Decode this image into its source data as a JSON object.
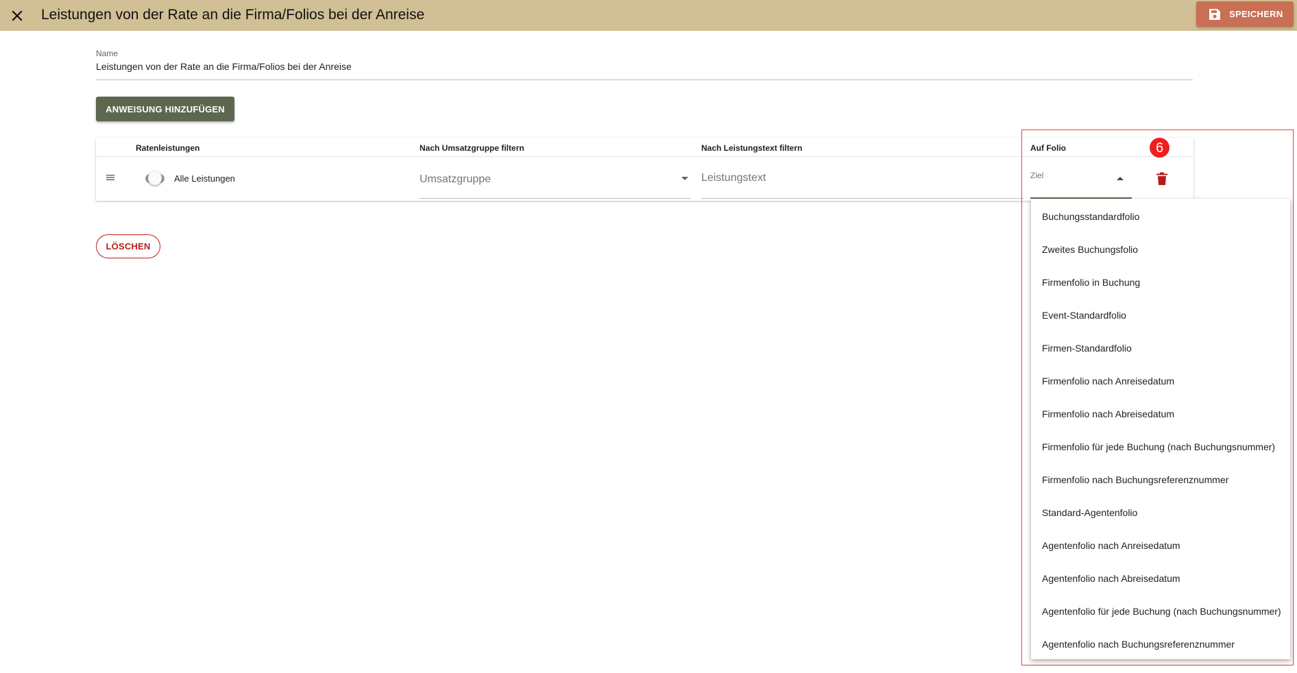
{
  "header": {
    "title": "Leistungen von der Rate an die Firma/Folios bei der Anreise",
    "close_icon": "close-icon",
    "save_label": "SPEICHERN",
    "save_icon": "floppy-disk-icon",
    "background_color": "#d1bf95",
    "save_color": "#c86f54"
  },
  "name_field": {
    "label": "Name",
    "value": "Leistungen von der Rate an die Firma/Folios bei der Anreise"
  },
  "add_instruction_label": "ANWEISUNG HINZUFÜGEN",
  "table": {
    "columns": [
      "Ratenleistungen",
      "Nach Umsatzgruppe filtern",
      "Nach Leistungstext filtern",
      "Auf Folio"
    ],
    "row": {
      "toggle_label": "Alle Leistungen",
      "toggle_on": false,
      "revenue_group_placeholder": "Umsatzgruppe",
      "service_text_placeholder": "Leistungstext",
      "target_label": "Ziel"
    }
  },
  "delete_label": "LÖSCHEN",
  "annotation": {
    "step_number": "6",
    "color": "#f01e1e"
  },
  "dropdown": {
    "options": [
      "Buchungsstandardfolio",
      "Zweites Buchungsfolio",
      "Firmenfolio in Buchung",
      "Event-Standardfolio",
      "Firmen-Standardfolio",
      "Firmenfolio nach Anreisedatum",
      "Firmenfolio nach Abreisedatum",
      "Firmenfolio für jede Buchung (nach Buchungsnummer)",
      "Firmenfolio nach Buchungsreferenznummer",
      "Standard-Agentenfolio",
      "Agentenfolio nach Anreisedatum",
      "Agentenfolio nach Abreisedatum",
      "Agentenfolio für jede Buchung (nach Buchungsnummer)",
      "Agentenfolio nach Buchungsreferenznummer"
    ]
  }
}
